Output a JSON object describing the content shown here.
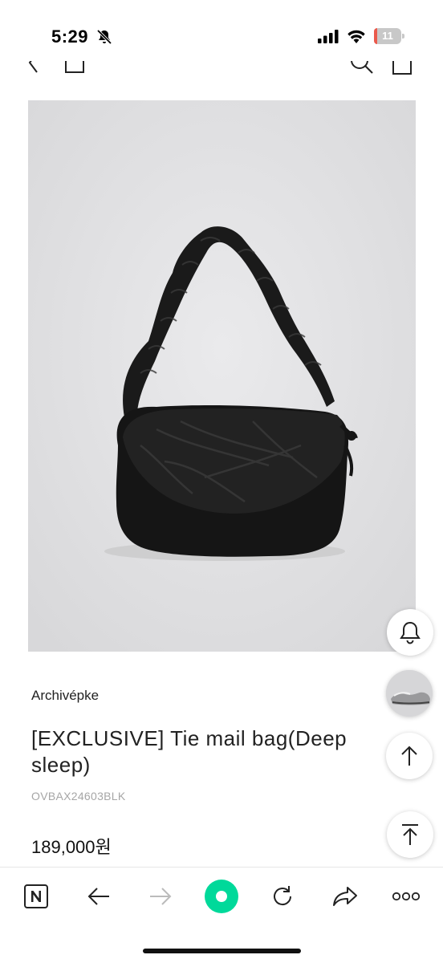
{
  "status_bar": {
    "time": "5:29",
    "battery_percent": "11",
    "battery_level": 0.11,
    "icons": [
      "bell-slash-icon",
      "cellular-signal-icon",
      "wifi-icon",
      "battery-icon"
    ]
  },
  "top_nav": {
    "icons": [
      "back-chevron-icon",
      "home-icon",
      "search-icon",
      "cart-icon"
    ]
  },
  "product": {
    "brand": "Archivépke",
    "title": "[EXCLUSIVE] Tie mail bag(Deep sleep)",
    "code": "OVBAX24603BLK",
    "price": "189,000원",
    "image_alt": "black ruched shoulder bag"
  },
  "floating_buttons": [
    "bell-icon",
    "recent-product-thumbnail",
    "arrow-up-icon",
    "scroll-to-top-icon"
  ],
  "toolbar": {
    "icons": [
      "naver-n-icon",
      "back-arrow-icon",
      "forward-arrow-icon",
      "green-dot-icon",
      "refresh-icon",
      "share-icon",
      "more-icon"
    ]
  },
  "colors": {
    "accent_green": "#00d99a",
    "battery_low": "#ea5a4c",
    "image_background": "#e2e2e4",
    "code_gray": "#a6a6a6"
  }
}
